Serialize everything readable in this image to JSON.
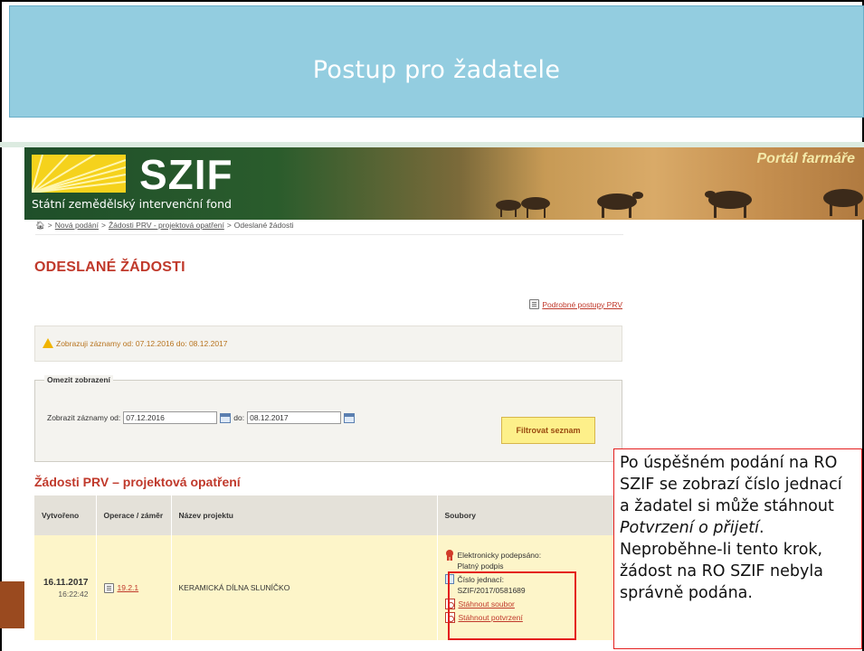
{
  "slide": {
    "title": "Postup pro žadatele"
  },
  "banner": {
    "logo_text": "SZIF",
    "subtitle": "Státní zemědělský intervenční fond",
    "portal": "Portál farmáře"
  },
  "breadcrumb": {
    "items": [
      "Nová podání",
      "Žádosti PRV - projektová opatření"
    ],
    "current": "Odeslané žádosti",
    "separator": ">"
  },
  "page": {
    "title": "ODESLANÉ ŽÁDOSTI",
    "help_link": "Podrobné postupy PRV",
    "info": "Zobrazuji záznamy od: 07.12.2016 do: 08.12.2017"
  },
  "filter": {
    "legend": "Omezit zobrazení",
    "from_label": "Zobrazit záznamy od:",
    "from_value": "07.12.2016",
    "to_label": "do:",
    "to_value": "08.12.2017",
    "button": "Filtrovat seznam"
  },
  "section": {
    "title": "Žádosti PRV – projektová opatření"
  },
  "table": {
    "headers": {
      "created": "Vytvořeno",
      "operation": "Operace / záměr",
      "name": "Název projektu",
      "files": "Soubory"
    },
    "rows": [
      {
        "date": "16.11.2017",
        "time": "16:22:42",
        "operation": "19.2.1",
        "name": "KERAMICKÁ DÍLNA SLUNÍČKO",
        "signed_label": "Elektronicky podepsáno:",
        "signed_value": "Platný podpis",
        "ref_label": "Číslo jednací:",
        "ref_value": "SZIF/2017/0581689",
        "download_file": "Stáhnout soubor",
        "download_confirmation": "Stáhnout potvrzení"
      }
    ]
  },
  "callout": {
    "text_1": "Po úspěšném podání na RO SZIF se zobrazí číslo jednací a žadatel si může stáhnout ",
    "text_em": "Potvrzení o přijetí",
    "text_2": ".",
    "text_3": "Neproběhne-li tento krok, žádost na RO SZIF nebyla správně podána."
  },
  "colors": {
    "title_band": "#93cde0",
    "accent_red": "#c0392b",
    "highlight_red": "#e41e1e",
    "button_yellow": "#fdf08a",
    "row_yellow": "#fdf5c9"
  }
}
